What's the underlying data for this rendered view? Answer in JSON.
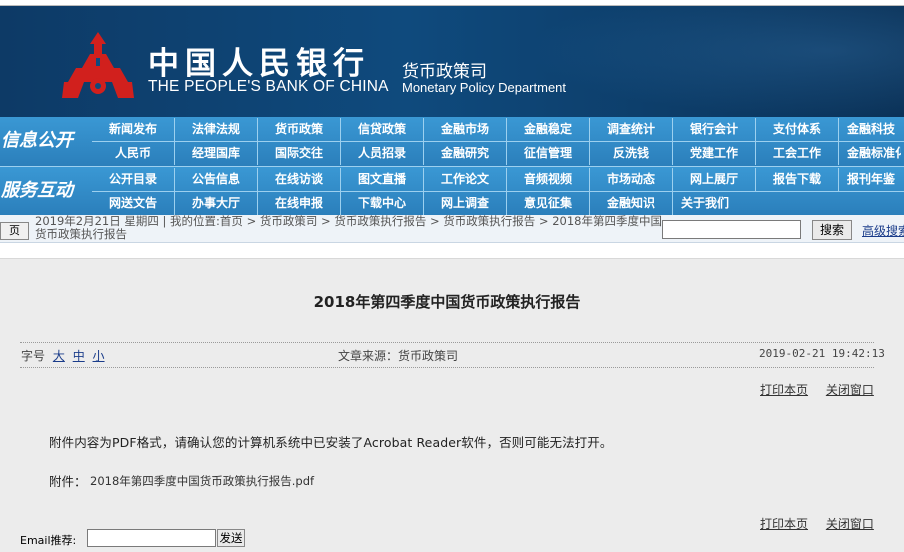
{
  "header": {
    "cn_name": "中国人民银行",
    "en_name": "THE PEOPLE'S BANK OF CHINA",
    "dept_cn": "货币政策司",
    "dept_en": "Monetary Policy Department",
    "emblem_color": "#d1201d"
  },
  "nav": {
    "cat1": "信息公开",
    "cat2": "服务互动",
    "row1": [
      "新闻发布",
      "法律法规",
      "货币政策",
      "信贷政策",
      "金融市场",
      "金融稳定",
      "调查统计",
      "银行会计",
      "支付体系",
      "金融科技"
    ],
    "row2": [
      "人民币",
      "经理国库",
      "国际交往",
      "人员招录",
      "金融研究",
      "征信管理",
      "反洗钱",
      "党建工作",
      "工会工作",
      "金融标准化"
    ],
    "row3": [
      "公开目录",
      "公告信息",
      "在线访谈",
      "图文直播",
      "工作论文",
      "音频视频",
      "市场动态",
      "网上展厅",
      "报告下载",
      "报刊年鉴"
    ],
    "row4": [
      "网送文告",
      "办事大厅",
      "在线申报",
      "下载中心",
      "网上调查",
      "意见征集",
      "金融知识",
      "关于我们"
    ]
  },
  "crumb": {
    "home": "页",
    "text": "2019年2月21日 星期四 | 我的位置:首页  >  货币政策司  >  货币政策执行报告  >  货币政策执行报告  >  2018年第四季度中国货币政策执行报告",
    "search_button": "搜索",
    "advanced": "高级搜索"
  },
  "article": {
    "title": "2018年第四季度中国货币政策执行报告",
    "font_label": "字号",
    "font_large": "大",
    "font_medium": "中",
    "font_small": "小",
    "source": "文章来源：货币政策司",
    "datetime": "2019-02-21 19:42:13",
    "print": "打印本页",
    "close": "关闭窗口",
    "notice": "附件内容为PDF格式，请确认您的计算机系统中已安装了Acrobat Reader软件，否则可能无法打开。",
    "attach_label": "附件：",
    "attach_file": "2018年第四季度中国货币政策执行报告.pdf"
  },
  "email": {
    "label": "Email推荐:",
    "send": "发送"
  }
}
